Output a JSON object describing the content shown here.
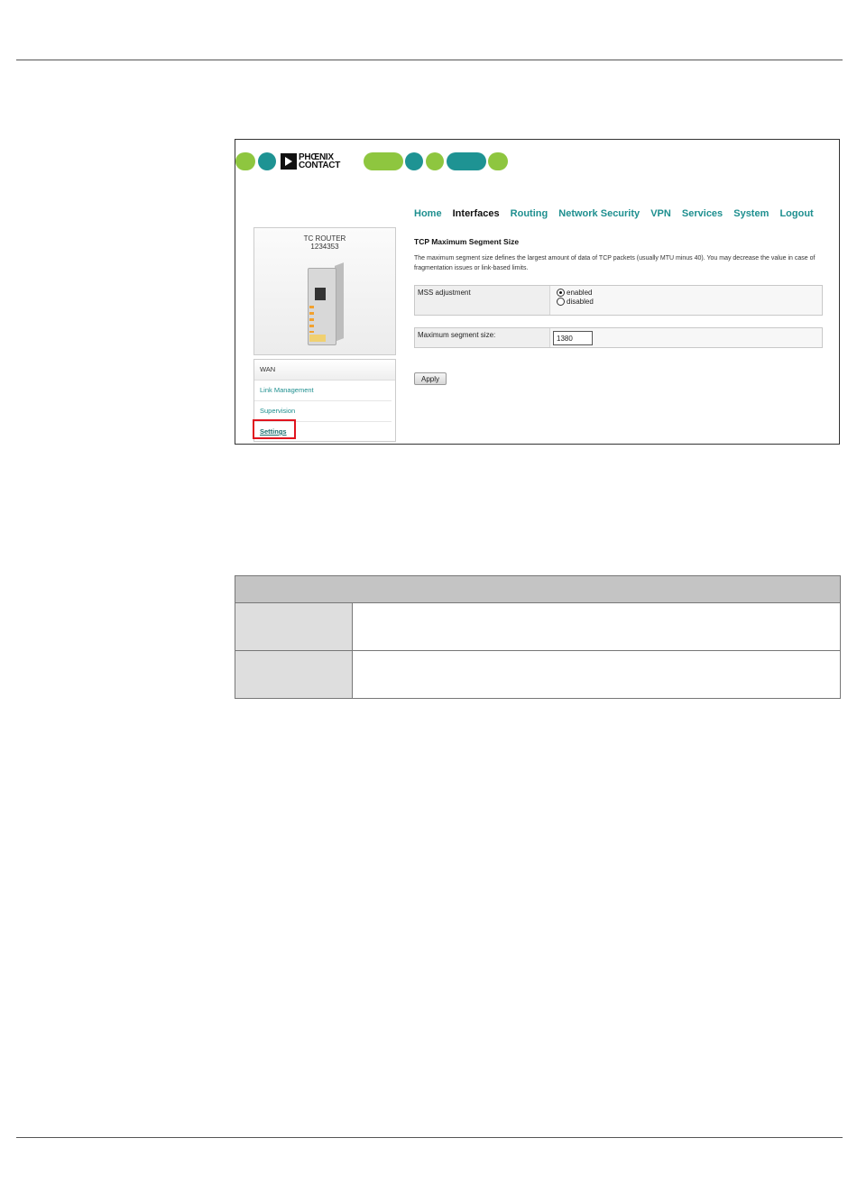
{
  "logo": {
    "line1": "PHŒNIX",
    "line2": "CONTACT"
  },
  "nav": [
    "Home",
    "Interfaces",
    "Routing",
    "Network Security",
    "VPN",
    "Services",
    "System",
    "Logout"
  ],
  "nav_active": "Interfaces",
  "device": {
    "name": "TC ROUTER",
    "id": "1234353"
  },
  "menu": {
    "header": "WAN",
    "items": [
      "Link Management",
      "Supervision",
      "Settings"
    ],
    "selected": "Settings"
  },
  "content": {
    "title": "TCP Maximum Segment Size",
    "description": "The maximum segment size defines the largest amount of data of TCP packets (usually MTU minus 40). You may decrease the value in case of fragmentation issues or link-based limits.",
    "mss_label": "MSS adjustment",
    "mss_options": [
      "enabled",
      "disabled"
    ],
    "mss_selected": "enabled",
    "max_seg_label": "Maximum segment size:",
    "max_seg_value": "1380",
    "apply_label": "Apply"
  },
  "colors": {
    "brand_green": "#8ec63f",
    "brand_teal": "#1e9393",
    "highlight_red": "#e0141e"
  }
}
